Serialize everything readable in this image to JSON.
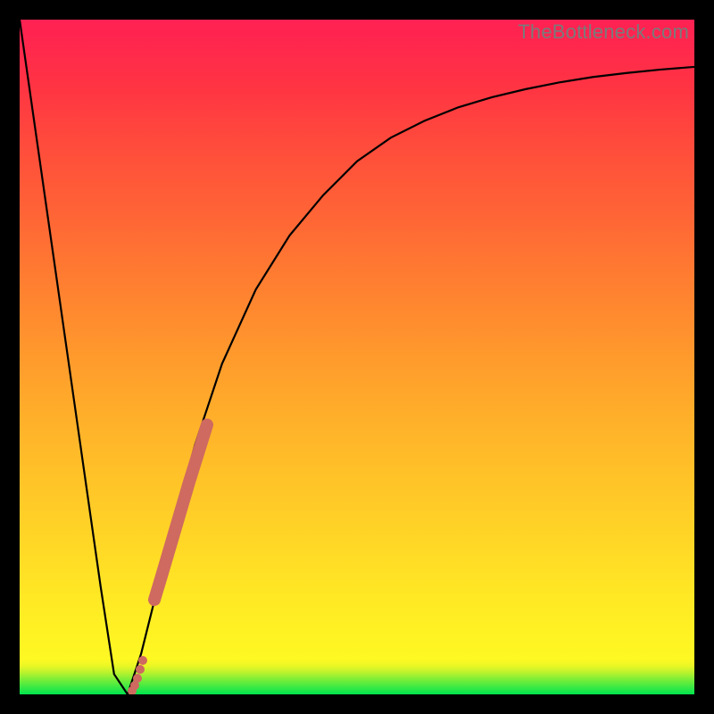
{
  "watermark": "TheBottleneck.com",
  "colors": {
    "frame": "#000000",
    "curve": "#000000",
    "highlight": "#cf6a60",
    "gradient_top": "#ff2253",
    "gradient_bottom": "#00e54f"
  },
  "chart_data": {
    "type": "line",
    "title": "",
    "xlabel": "",
    "ylabel": "",
    "xlim": [
      0,
      100
    ],
    "ylim": [
      0,
      100
    ],
    "grid": false,
    "legend": false,
    "series": [
      {
        "name": "bottleneck-curve",
        "x": [
          0,
          3,
          6,
          9,
          12,
          14,
          16,
          18,
          20,
          23,
          26,
          30,
          35,
          40,
          45,
          50,
          55,
          60,
          65,
          70,
          75,
          80,
          85,
          90,
          95,
          100
        ],
        "y": [
          100,
          79,
          58,
          37,
          16,
          3,
          0,
          6,
          14,
          26,
          37,
          49,
          60,
          68,
          74,
          79,
          82.5,
          85,
          87,
          88.5,
          89.7,
          90.7,
          91.5,
          92.1,
          92.6,
          93
        ]
      }
    ],
    "annotations": [
      {
        "name": "highlight-segment",
        "description": "thick salmon overlay on the rising branch near the minimum",
        "x_range": [
          17.5,
          28.0
        ]
      }
    ]
  }
}
